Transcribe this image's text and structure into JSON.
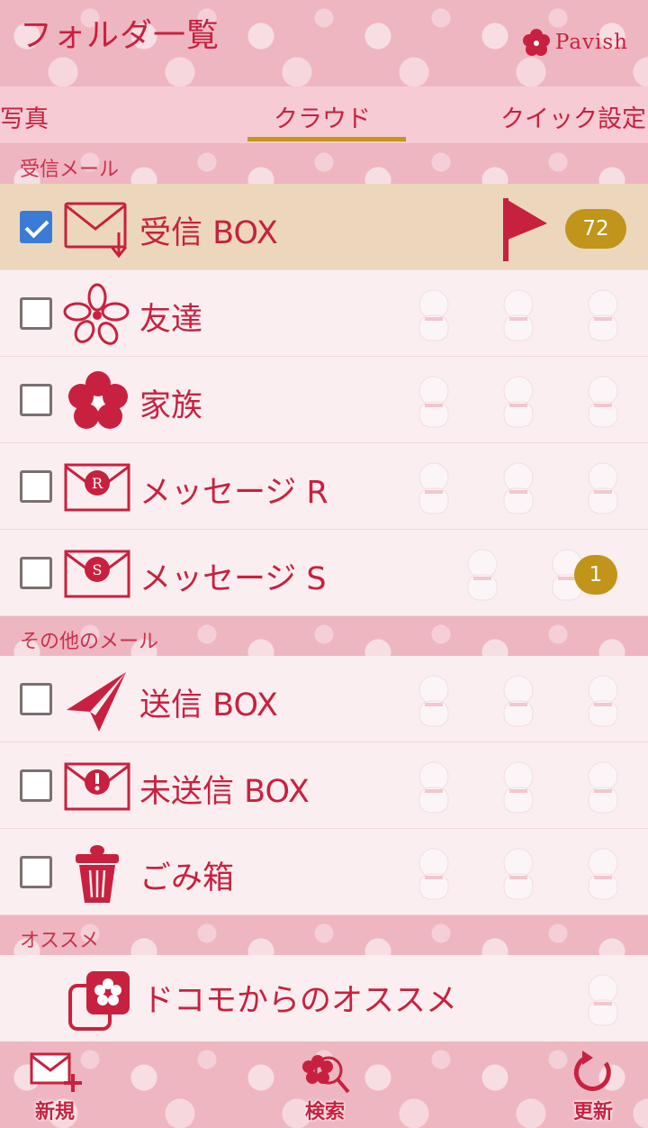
{
  "header": {
    "title": "フォルダ一覧",
    "brand": "Pavish"
  },
  "tabs": [
    {
      "label": "写真"
    },
    {
      "label": "クラウド",
      "active": true
    },
    {
      "label": "クイック設定"
    }
  ],
  "sections": [
    {
      "label": "受信メール",
      "folders": [
        {
          "name": "受信 BOX",
          "icon": "inbox-envelope-icon",
          "checked": true,
          "badge": "72",
          "flagged": true
        },
        {
          "name": "友達",
          "icon": "flower-icon",
          "checked": false
        },
        {
          "name": "家族",
          "icon": "plum-blossom-icon",
          "checked": false
        },
        {
          "name": "メッセージ R",
          "icon": "envelope-r-icon",
          "checked": false
        },
        {
          "name": "メッセージ S",
          "icon": "envelope-s-icon",
          "checked": false,
          "badge": "1"
        }
      ]
    },
    {
      "label": "その他のメール",
      "folders": [
        {
          "name": "送信 BOX",
          "icon": "paper-plane-icon",
          "checked": false
        },
        {
          "name": "未送信 BOX",
          "icon": "envelope-exclamation-icon",
          "checked": false
        },
        {
          "name": "ごみ箱",
          "icon": "trash-can-icon",
          "checked": false
        }
      ]
    },
    {
      "label": "オススメ",
      "folders": [
        {
          "name": "ドコモからのオススメ",
          "icon": "recommend-icon"
        }
      ]
    }
  ],
  "bottom_bar": {
    "new_label": "新規",
    "search_label": "検索",
    "refresh_label": "更新"
  },
  "colors": {
    "accent": "#c8213f",
    "gold": "#c19519",
    "selected_row": "#ecd7bd",
    "row": "#fbeef1",
    "pattern": "#eeb6c1"
  }
}
